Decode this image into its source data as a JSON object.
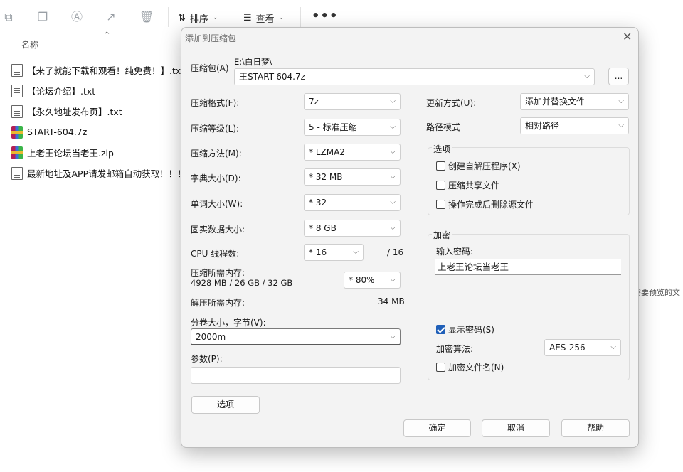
{
  "explorer": {
    "toolbar": {
      "sort_label": "排序",
      "view_label": "查看",
      "more_label": "•••"
    },
    "column_name": "名称",
    "files": [
      {
        "name": "【来了就能下载和观看！纯免费！】.txt",
        "type": "txt"
      },
      {
        "name": "【论坛介绍】.txt",
        "type": "txt"
      },
      {
        "name": "【永久地址发布页】.txt",
        "type": "txt"
      },
      {
        "name": "START-604.7z",
        "type": "archive"
      },
      {
        "name": "上老王论坛当老王.zip",
        "type": "archive"
      },
      {
        "name": "最新地址及APP请发邮箱自动获取！！！",
        "type": "txt"
      }
    ],
    "stray_text": "需要预览的文"
  },
  "dialog": {
    "title": "添加到压缩包",
    "archive": {
      "label": "压缩包(A)",
      "path": "E:\\白日梦\\",
      "value": "王START-604.7z",
      "browse_label": "..."
    },
    "left": {
      "format": {
        "label": "压缩格式(F):",
        "value": "7z"
      },
      "level": {
        "label": "压缩等级(L):",
        "value": "5 - 标准压缩"
      },
      "method": {
        "label": "压缩方法(M):",
        "value": "* LZMA2"
      },
      "dict": {
        "label": "字典大小(D):",
        "value": "* 32 MB"
      },
      "word": {
        "label": "单词大小(W):",
        "value": "* 32"
      },
      "solid": {
        "label": "固实数据大小:",
        "value": "* 8 GB"
      },
      "cpu": {
        "label": "CPU 线程数:",
        "value": "* 16",
        "total": "/ 16"
      },
      "mem_comp": {
        "label": "压缩所需内存:",
        "detail": "4928 MB / 26 GB / 32 GB",
        "value": "* 80%"
      },
      "mem_decomp": {
        "label": "解压所需内存:",
        "value": "34 MB"
      },
      "split": {
        "label": "分卷大小，字节(V):",
        "value": "2000m"
      },
      "params": {
        "label": "参数(P):",
        "value": ""
      },
      "options_button": "选项"
    },
    "right": {
      "update": {
        "label": "更新方式(U):",
        "value": "添加并替换文件"
      },
      "path_mode": {
        "label": "路径模式",
        "value": "相对路径"
      },
      "options_group": {
        "title": "选项",
        "sfx": "创建自解压程序(X)",
        "shared": "压缩共享文件",
        "delete_after": "操作完成后删除源文件"
      },
      "encryption_group": {
        "title": "加密",
        "password_label": "输入密码:",
        "password_value": "上老王论坛当老王",
        "show_password": "显示密码(S)",
        "method_label": "加密算法:",
        "method_value": "AES-256",
        "encrypt_names": "加密文件名(N)"
      }
    },
    "buttons": {
      "ok": "确定",
      "cancel": "取消",
      "help": "帮助"
    }
  }
}
